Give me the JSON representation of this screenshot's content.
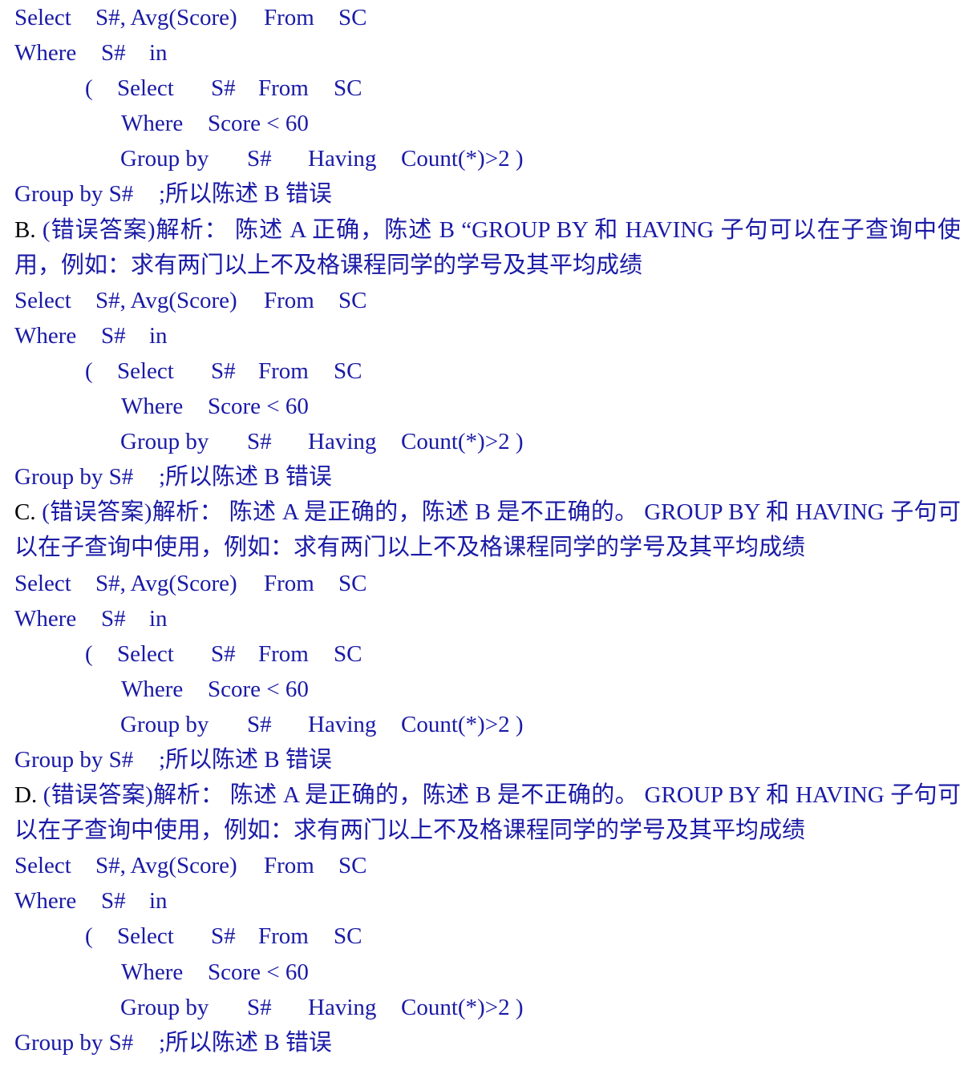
{
  "sql": {
    "select_kw": "Select",
    "cols": "S#, Avg(Score)",
    "from_kw": "From",
    "table": "SC",
    "where_kw": "Where",
    "sid": "S#",
    "in_kw": "in",
    "paren_open": "(",
    "sub_select_kw": "Select",
    "sub_sid": "S#",
    "sub_from_kw": "From",
    "sub_table": "SC",
    "sub_where_kw": "Where",
    "cond": "Score < 60",
    "sub_group_kw": "Group by",
    "sub_group_sid": "S#",
    "having_kw": "Having",
    "having_cond": "Count(*)>2 )",
    "outer_group": "Group by S#",
    "conclusion": ";所以陈述 B 错误"
  },
  "options": [
    {
      "label": "B.",
      "text": "(错误答案)解析： 陈述 A 正确，陈述 B “GROUP BY 和 HAVING 子句可以在子查询中使用，例如：求有两门以上不及格课程同学的学号及其平均成绩"
    },
    {
      "label": "C.",
      "text": "(错误答案)解析： 陈述 A 是正确的，陈述 B 是不正确的。 GROUP BY 和 HAVING 子句可以在子查询中使用，例如：求有两门以上不及格课程同学的学号及其平均成绩"
    },
    {
      "label": "D.",
      "text": "(错误答案)解析： 陈述 A 是正确的，陈述 B 是不正确的。 GROUP BY 和 HAVING 子句可以在子查询中使用，例如：求有两门以上不及格课程同学的学号及其平均成绩"
    }
  ]
}
